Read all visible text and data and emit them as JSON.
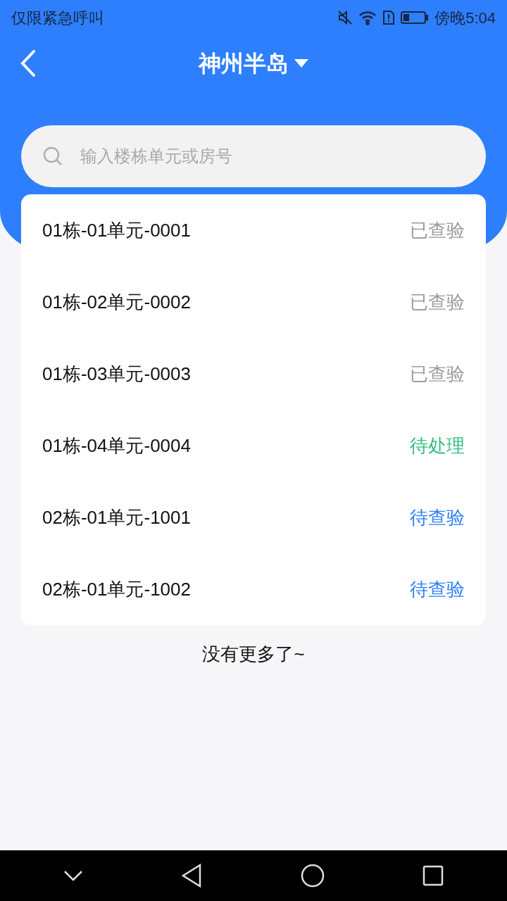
{
  "status_bar": {
    "carrier": "仅限紧急呼叫",
    "time": "傍晚5:04"
  },
  "header": {
    "title": "神州半岛"
  },
  "search": {
    "placeholder": "输入楼栋单元或房号"
  },
  "rooms": [
    {
      "name": "01栋-01单元-0001",
      "status": "已查验",
      "kind": "done"
    },
    {
      "name": "01栋-02单元-0002",
      "status": "已查验",
      "kind": "done"
    },
    {
      "name": "01栋-03单元-0003",
      "status": "已查验",
      "kind": "done"
    },
    {
      "name": "01栋-04单元-0004",
      "status": "待处理",
      "kind": "processing"
    },
    {
      "name": "02栋-01单元-1001",
      "status": "待查验",
      "kind": "pending"
    },
    {
      "name": "02栋-01单元-1002",
      "status": "待查验",
      "kind": "pending"
    }
  ],
  "footer": "没有更多了~"
}
